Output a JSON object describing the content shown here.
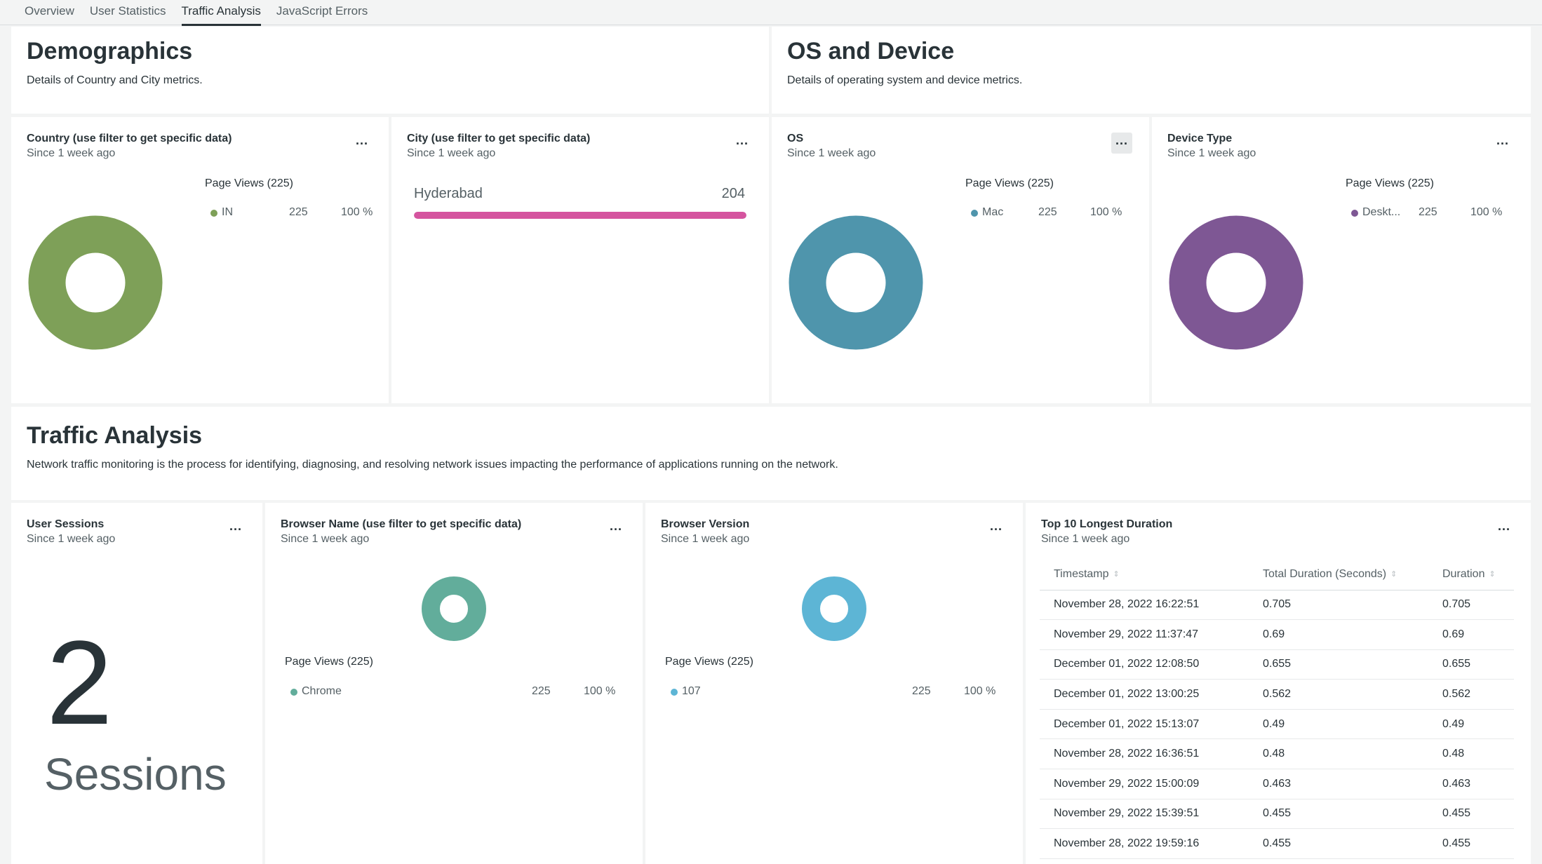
{
  "tabs": [
    {
      "label": "Overview",
      "active": false
    },
    {
      "label": "User Statistics",
      "active": false
    },
    {
      "label": "Traffic Analysis",
      "active": true
    },
    {
      "label": "JavaScript Errors",
      "active": false
    }
  ],
  "demographics": {
    "title": "Demographics",
    "description": "Details of Country and City metrics."
  },
  "os_device": {
    "title": "OS and Device",
    "description": "Details of operating system and device metrics."
  },
  "traffic": {
    "title": "Traffic Analysis",
    "description": "Network traffic monitoring is the process for identifying, diagnosing, and resolving network issues impacting the performance of applications running on the network."
  },
  "menu_icon": "ellipsis-icon",
  "menu_label": "...",
  "widgets": {
    "country": {
      "title": "Country (use filter to get specific data)",
      "subtitle": "Since 1 week ago",
      "legend_title": "Page Views (225)",
      "item": {
        "name": "IN",
        "value": "225",
        "percent": "100 %"
      },
      "color": "#7ea058"
    },
    "city": {
      "title": "City (use filter to get specific data)",
      "subtitle": "Since 1 week ago",
      "bar": {
        "label": "Hyderabad",
        "value": "204",
        "fraction": 1.0
      },
      "color": "#d5549f"
    },
    "os": {
      "title": "OS",
      "subtitle": "Since 1 week ago",
      "legend_title": "Page Views (225)",
      "item": {
        "name": "Mac",
        "value": "225",
        "percent": "100 %"
      },
      "color": "#4f95ac"
    },
    "device": {
      "title": "Device Type",
      "subtitle": "Since 1 week ago",
      "legend_title": "Page Views (225)",
      "item": {
        "name": "Deskt...",
        "value": "225",
        "percent": "100 %"
      },
      "color": "#7e5794"
    },
    "sessions": {
      "title": "User Sessions",
      "subtitle": "Since 1 week ago",
      "value": "2",
      "unit": "Sessions"
    },
    "browser_name": {
      "title": "Browser Name (use filter to get specific data)",
      "subtitle": "Since 1 week ago",
      "legend_title": "Page Views (225)",
      "item": {
        "name": "Chrome",
        "value": "225",
        "percent": "100 %"
      },
      "color": "#62ad9b"
    },
    "browser_version": {
      "title": "Browser Version",
      "subtitle": "Since 1 week ago",
      "legend_title": "Page Views (225)",
      "item": {
        "name": "107",
        "value": "225",
        "percent": "100 %"
      },
      "color": "#5db5d5"
    },
    "top_duration": {
      "title": "Top 10 Longest Duration",
      "subtitle": "Since 1 week ago",
      "columns": [
        "Timestamp",
        "Total Duration (Seconds)",
        "Duration"
      ],
      "rows": [
        [
          "November 28, 2022 16:22:51",
          "0.705",
          "0.705"
        ],
        [
          "November 29, 2022 11:37:47",
          "0.69",
          "0.69"
        ],
        [
          "December 01, 2022 12:08:50",
          "0.655",
          "0.655"
        ],
        [
          "December 01, 2022 13:00:25",
          "0.562",
          "0.562"
        ],
        [
          "December 01, 2022 15:13:07",
          "0.49",
          "0.49"
        ],
        [
          "November 28, 2022 16:36:51",
          "0.48",
          "0.48"
        ],
        [
          "November 29, 2022 15:00:09",
          "0.463",
          "0.463"
        ],
        [
          "November 29, 2022 15:39:51",
          "0.455",
          "0.455"
        ],
        [
          "November 28, 2022 19:59:16",
          "0.455",
          "0.455"
        ]
      ]
    }
  }
}
